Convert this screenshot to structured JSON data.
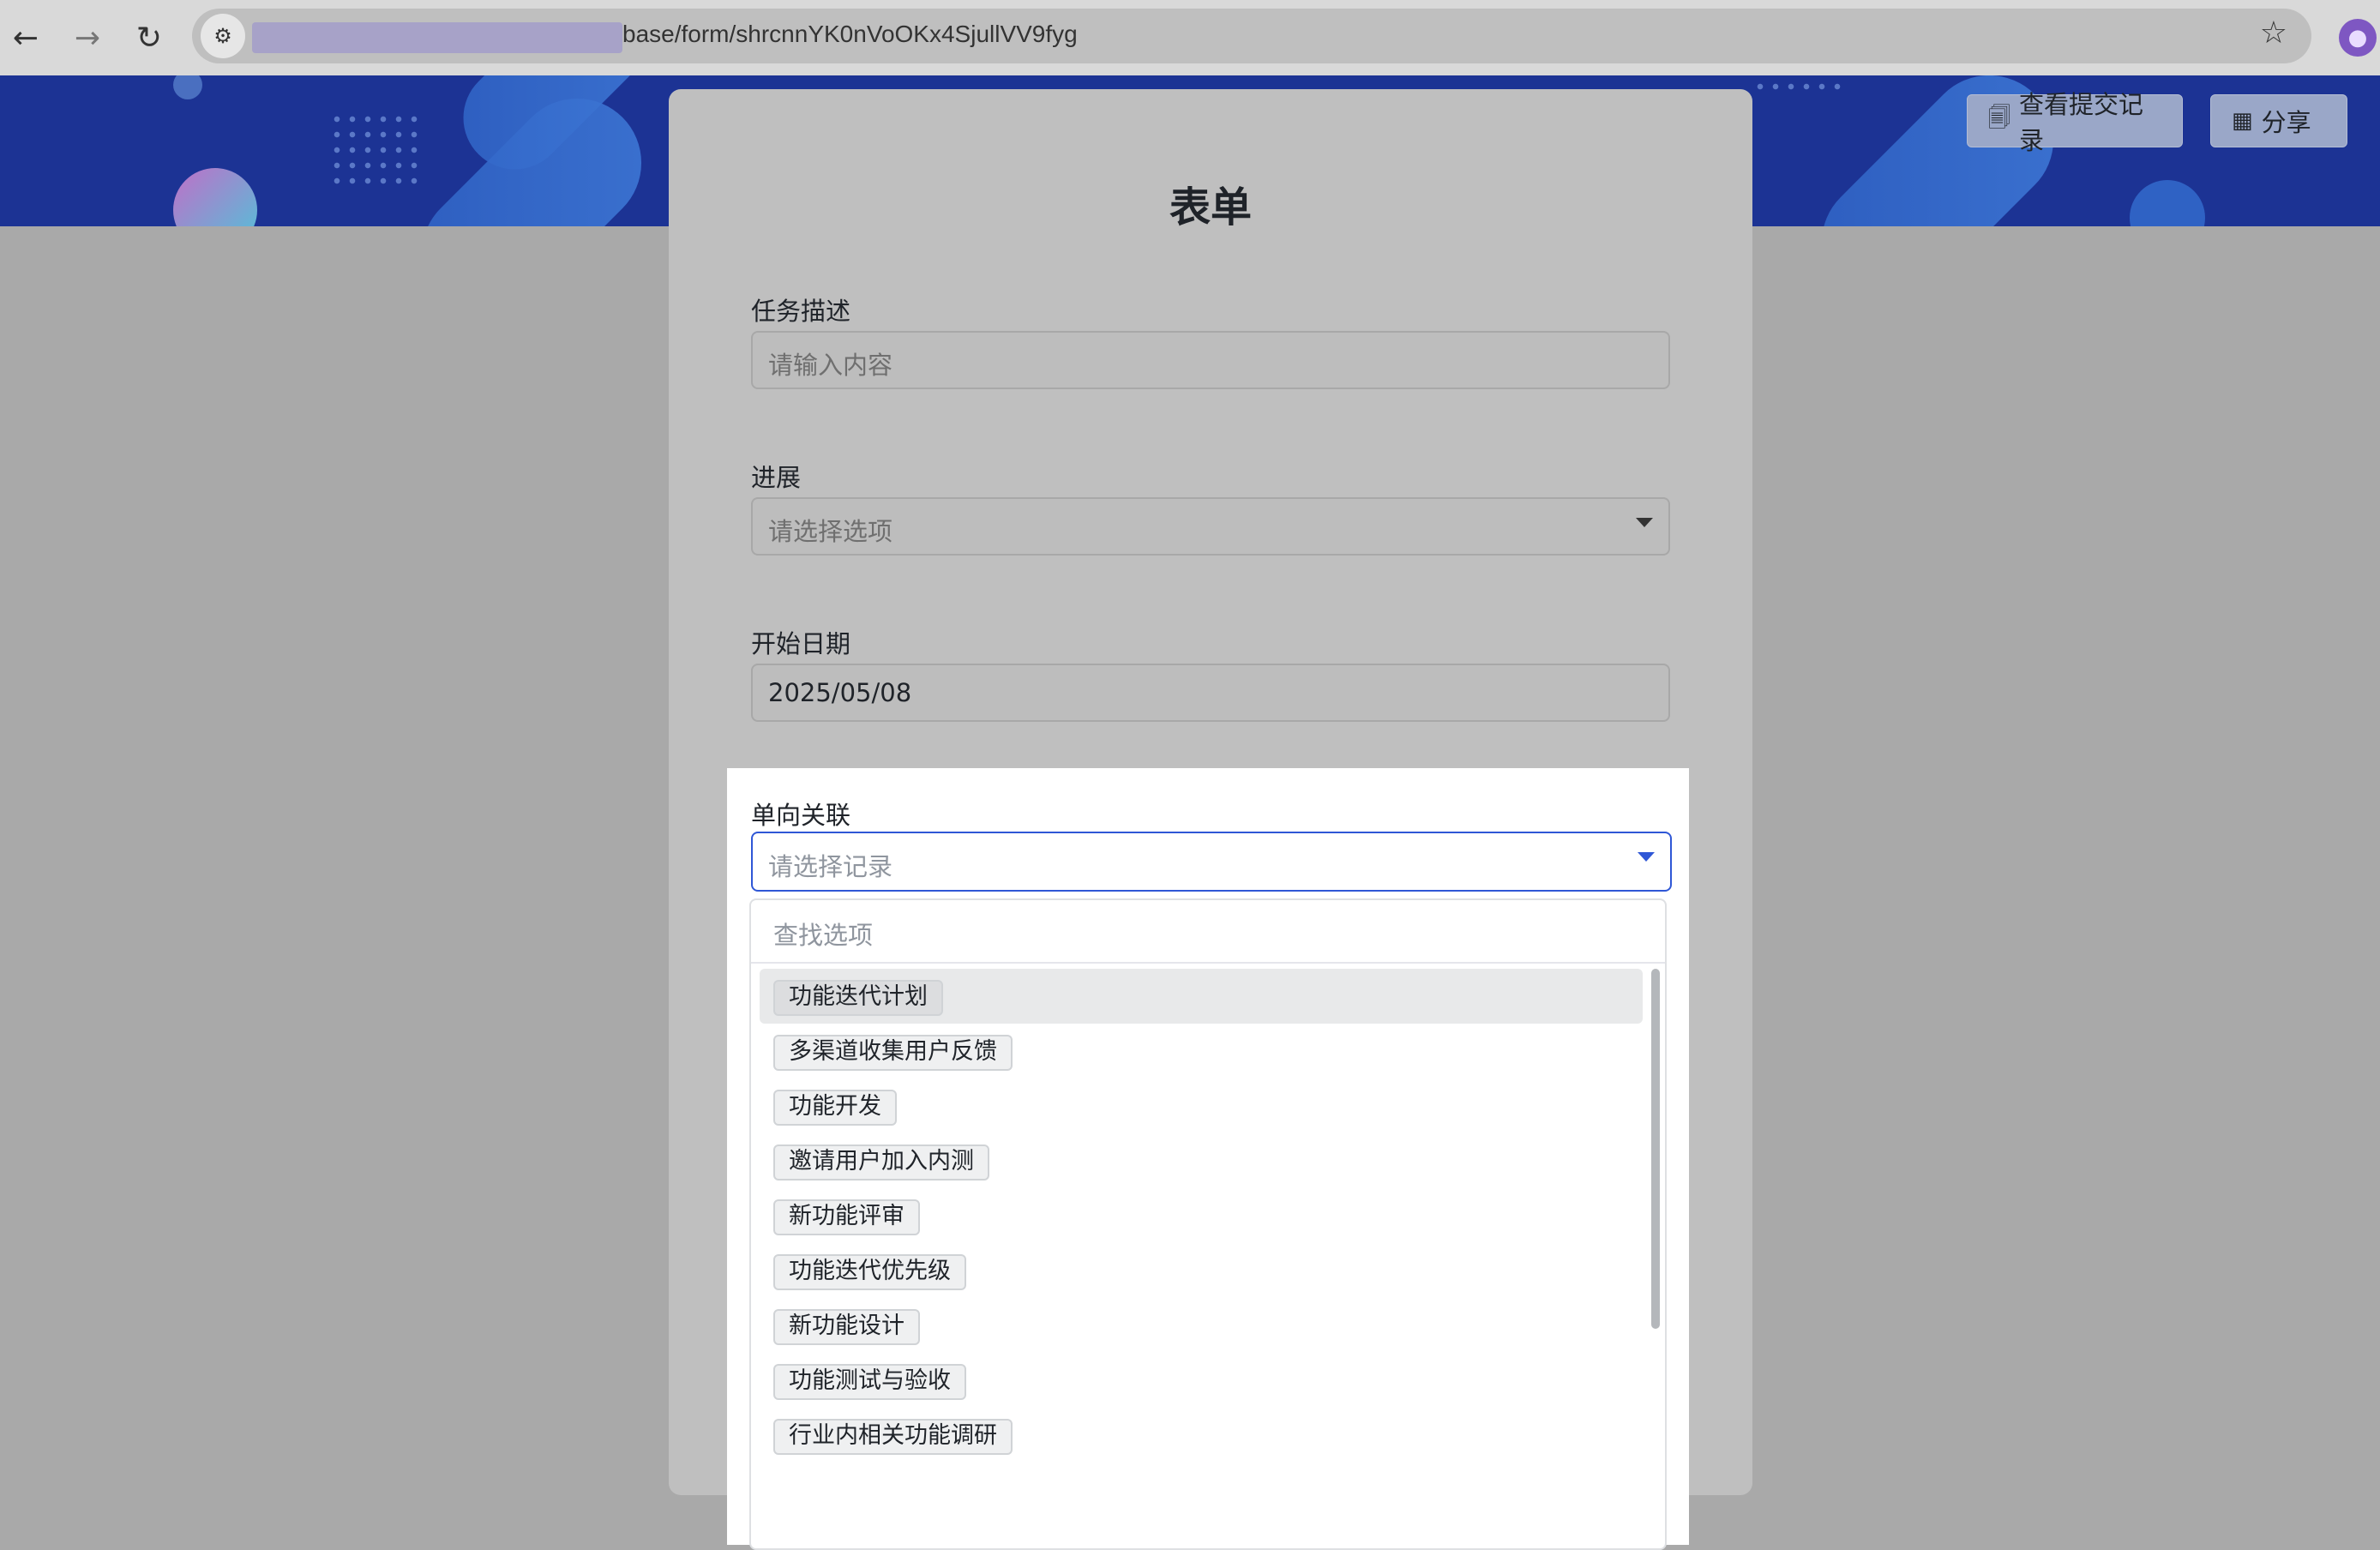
{
  "browser": {
    "url_visible": "base/form/shrcnnYK0nVoOKx4SjullVV9fyg",
    "back_icon": "←",
    "forward_icon": "→",
    "reload_icon": "↻",
    "star_icon": "☆"
  },
  "header": {
    "view_records_label": "查看提交记录",
    "share_label": "分享"
  },
  "form": {
    "title": "表单",
    "fields": {
      "task_desc": {
        "label": "任务描述",
        "placeholder": "请输入内容"
      },
      "progress": {
        "label": "进展",
        "placeholder": "请选择选项"
      },
      "start_date": {
        "label": "开始日期",
        "value": "2025/05/08"
      },
      "link": {
        "label": "单向关联",
        "placeholder": "请选择记录"
      }
    }
  },
  "dropdown": {
    "search_placeholder": "查找选项",
    "options": [
      "功能迭代计划",
      "多渠道收集用户反馈",
      "功能开发",
      "邀请用户加入内测",
      "新功能评审",
      "功能迭代优先级",
      "新功能设计",
      "功能测试与验收",
      "行业内相关功能调研"
    ]
  }
}
